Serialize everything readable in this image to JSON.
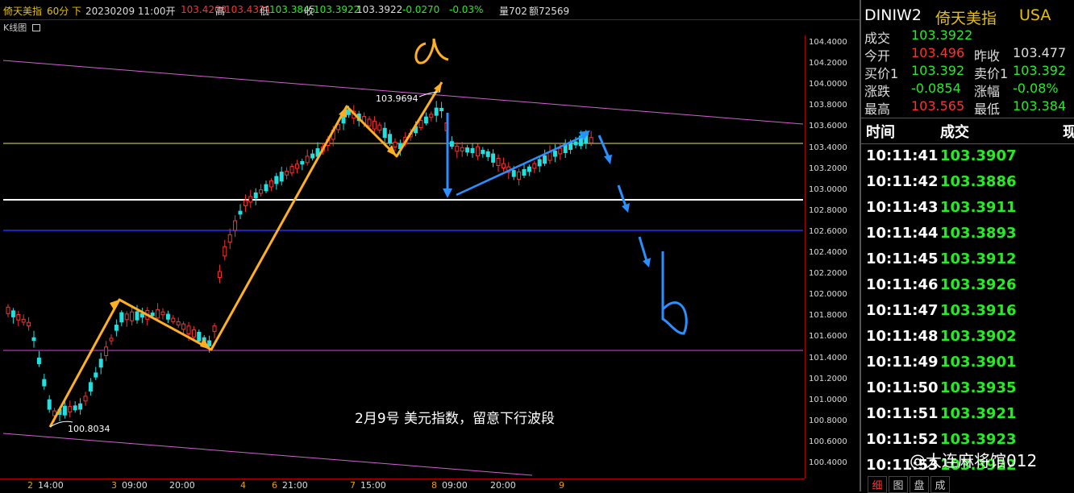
{
  "header": {
    "name": "倚天美指",
    "period": "60分",
    "dir": "下",
    "datetime_open": "20230209 11:00开",
    "open": "103.4208",
    "high_label": "高",
    "high": "103.4321",
    "low_label": "低",
    "low": "103.3845",
    "close_label": "收",
    "close": "103.3922",
    "last": "103.3922",
    "change": "-0.0270",
    "change_pct": "-0.03%",
    "volume": "量702",
    "amount": "额72569"
  },
  "chart_title": "K线图",
  "chart_icon": "window-icon",
  "annotation_text": "2月9号 美元指数，留意下行波段",
  "price_labels": {
    "high_point": "103.9694",
    "low_point": "100.8034"
  },
  "hand_marks": {
    "a": "a",
    "b": "b"
  },
  "y_ticks": [
    "104.4000",
    "104.2000",
    "104.0000",
    "103.8000",
    "103.6000",
    "103.4000",
    "103.2000",
    "103.0000",
    "102.8000",
    "102.6000",
    "102.4000",
    "102.2000",
    "102.0000",
    "101.8000",
    "101.6000",
    "101.4000",
    "101.2000",
    "101.0000",
    "100.8000",
    "100.6000",
    "100.4000"
  ],
  "x_ticks": [
    {
      "label": "2",
      "color": "#e8a000"
    },
    {
      "label": "14:00",
      "color": "#ddd"
    },
    {
      "label": "3",
      "color": "#e8a000"
    },
    {
      "label": "09:00",
      "color": "#ddd"
    },
    {
      "label": "20:00",
      "color": "#ddd"
    },
    {
      "label": "4",
      "color": "#e8a000"
    },
    {
      "label": "6",
      "color": "#e8a000"
    },
    {
      "label": "21:00",
      "color": "#ddd"
    },
    {
      "label": "7",
      "color": "#e8a000"
    },
    {
      "label": "15:00",
      "color": "#ddd"
    },
    {
      "label": "8",
      "color": "#e8a000"
    },
    {
      "label": "09:00",
      "color": "#ddd"
    },
    {
      "label": "20:00",
      "color": "#ddd"
    },
    {
      "label": "9",
      "color": "#e8a000"
    }
  ],
  "quote": {
    "symbol": "DINIW2",
    "name": "倚天美指",
    "market": "USA",
    "trade_label": "成交",
    "trade": "103.3922",
    "open_label": "今开",
    "open": "103.496",
    "prev_label": "昨收",
    "prev": "103.477",
    "bid_label": "买价1",
    "bid": "103.392",
    "ask_label": "卖价1",
    "ask": "103.392",
    "chg_label": "涨跌",
    "chg": "-0.0854",
    "chgpct_label": "涨幅",
    "chgpct": "-0.08%",
    "high_label": "最高",
    "high": "103.565",
    "low_label": "最低",
    "low": "103.384",
    "col_time": "时间",
    "col_trade": "成交",
    "col_extra": "现"
  },
  "ticks": [
    {
      "time": "10:11:41",
      "price": "103.3907"
    },
    {
      "time": "10:11:42",
      "price": "103.3886"
    },
    {
      "time": "10:11:43",
      "price": "103.3911"
    },
    {
      "time": "10:11:44",
      "price": "103.3893"
    },
    {
      "time": "10:11:45",
      "price": "103.3912"
    },
    {
      "time": "10:11:46",
      "price": "103.3926"
    },
    {
      "time": "10:11:47",
      "price": "103.3916"
    },
    {
      "time": "10:11:48",
      "price": "103.3902"
    },
    {
      "time": "10:11:49",
      "price": "103.3901"
    },
    {
      "time": "10:11:50",
      "price": "103.3935"
    },
    {
      "time": "10:11:51",
      "price": "103.3921"
    },
    {
      "time": "10:11:52",
      "price": "103.3923"
    },
    {
      "time": "10:11:53",
      "price": "103.3922"
    }
  ],
  "bottom_tabs": [
    "细",
    "图",
    "盘",
    "成"
  ],
  "watermark": "@大连麻将馆012",
  "colors": {
    "up": "#ff3030",
    "down": "#22ee22",
    "accent": "#e8c000",
    "pink": "#e060e0",
    "blue": "#2040ff",
    "orange_pen": "#ffb020",
    "blue_pen": "#2a90ff"
  }
}
